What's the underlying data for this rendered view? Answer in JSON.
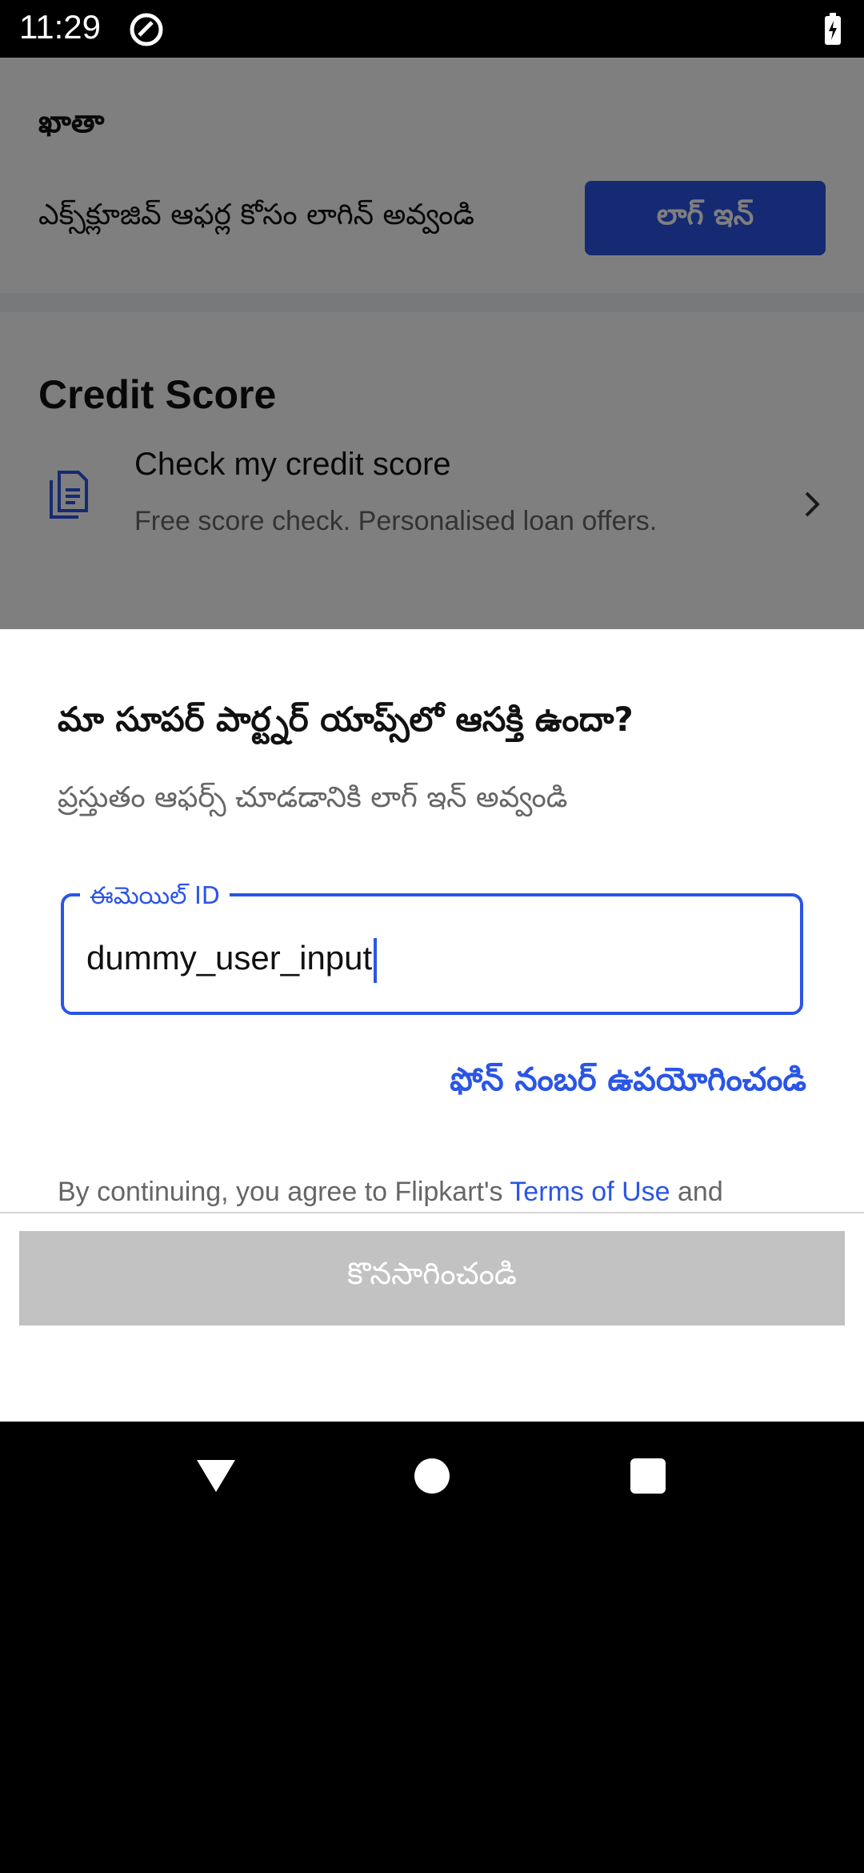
{
  "status_bar": {
    "time": "11:29"
  },
  "account": {
    "title": "ఖాతా",
    "subtitle": "ఎక్స్‌క్లూజివ్ ఆఫర్ల కోసం లాగిన్ అవ్వండి",
    "login_label": "లాగ్ ఇన్"
  },
  "credit": {
    "section_title": "Credit Score",
    "item_title": "Check my credit score",
    "item_subtitle": "Free score check. Personalised loan offers."
  },
  "sheet": {
    "title": "మా సూపర్ పార్ట్నర్ యాప్స్‌లో ఆసక్తి ఉందా?",
    "subtitle": "ప్రస్తుతం ఆఫర్స్ చూడడానికి లాగ్ ఇన్ అవ్వండి",
    "email_label": "ఈమెయిల్ ID",
    "email_value": "dummy_user_input",
    "phone_link": "ఫోన్ నంబర్ ఉపయోగించండి",
    "terms_prefix": "By continuing, you agree to Flipkart's ",
    "terms_link": "Terms of Use",
    "terms_suffix": " and",
    "continue_label": "కొనసాగించండి"
  },
  "colors": {
    "accent": "#2a55e5",
    "disabled_button": "#c2c2c2"
  }
}
